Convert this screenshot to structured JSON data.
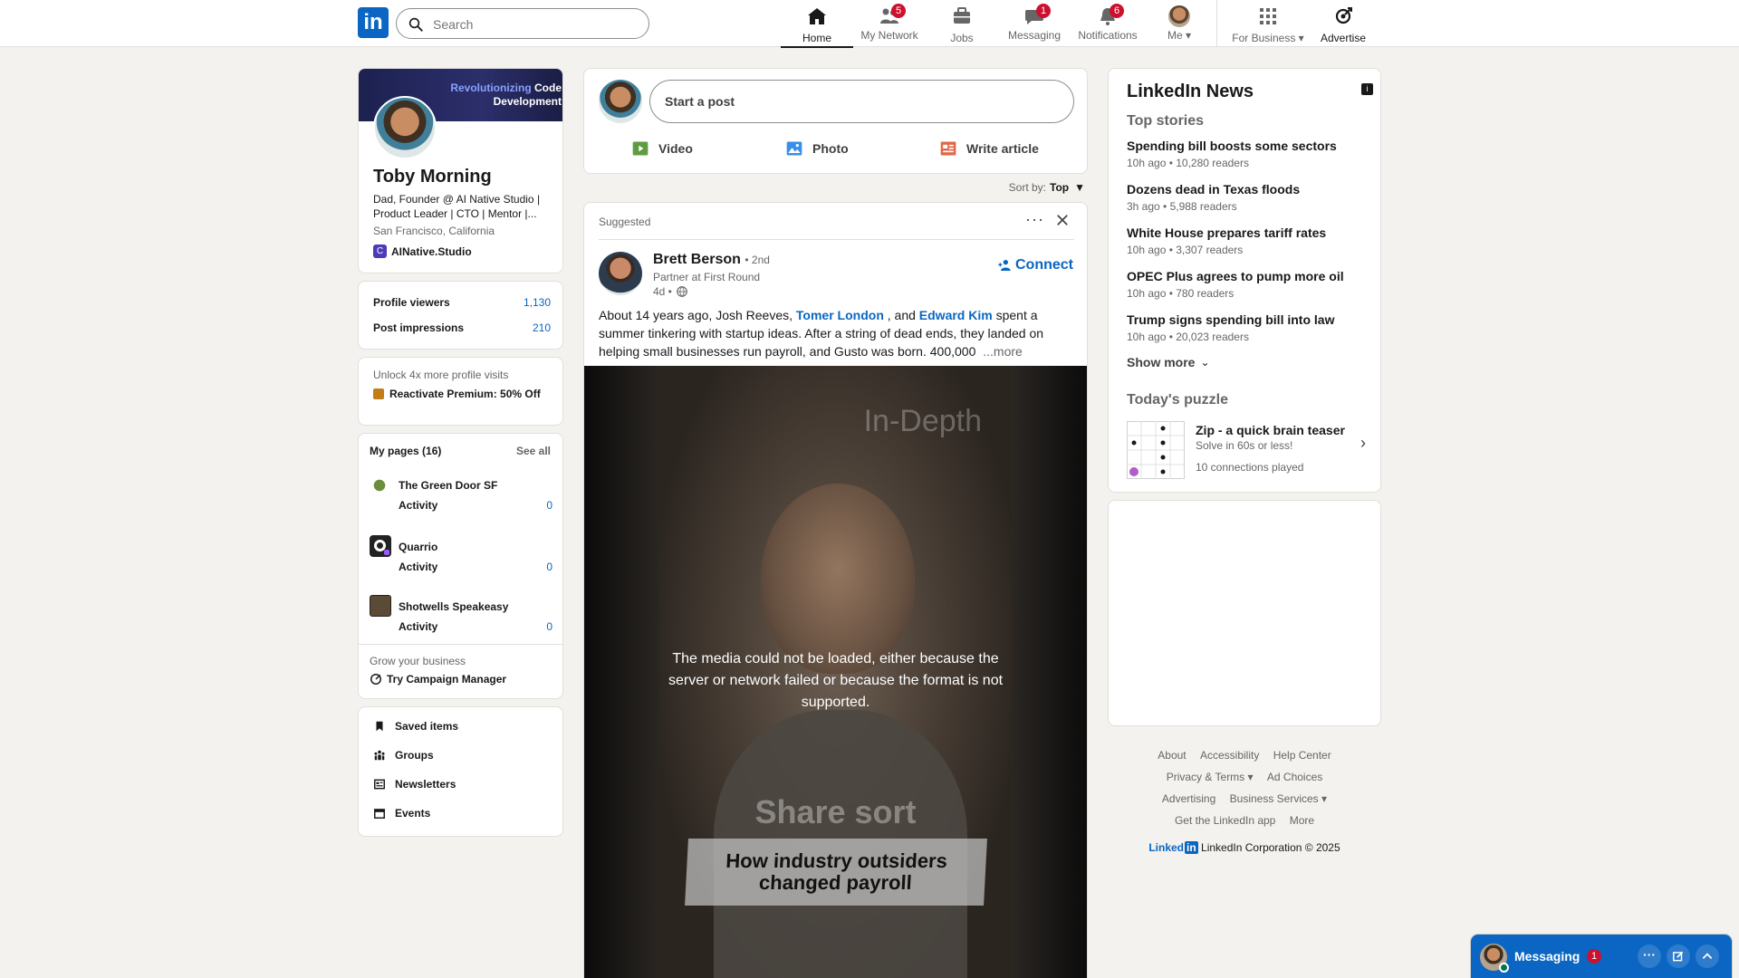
{
  "nav": {
    "search_placeholder": "Search",
    "items": [
      {
        "label": "Home"
      },
      {
        "label": "My Network",
        "badge": "5"
      },
      {
        "label": "Jobs"
      },
      {
        "label": "Messaging",
        "badge": "1"
      },
      {
        "label": "Notifications",
        "badge": "6"
      },
      {
        "label": "Me"
      },
      {
        "label": "For Business"
      },
      {
        "label": "Advertise"
      }
    ],
    "logo_text": "in"
  },
  "profile": {
    "banner_line1": "Revolutionizing",
    "banner_line1b": "Code",
    "banner_line2": "Development",
    "name": "Toby Morning",
    "headline": "Dad, Founder @ AI Native Studio | Product Leader | CTO | Mentor |...",
    "location": "San Francisco, California",
    "company": "AINative.Studio",
    "company_initial": "C",
    "stats": [
      {
        "label": "Profile viewers",
        "value": "1,130"
      },
      {
        "label": "Post impressions",
        "value": "210"
      }
    ],
    "premium_title": "Unlock 4x more profile visits",
    "premium_cta": "Reactivate Premium: 50% Off"
  },
  "pages": {
    "title": "My pages (16)",
    "see_all": "See all",
    "items": [
      {
        "name": "The Green Door SF",
        "activity": "Activity",
        "count": "0"
      },
      {
        "name": "Quarrio",
        "activity": "Activity",
        "count": "0"
      },
      {
        "name": "Shotwells Speakeasy",
        "activity": "Activity",
        "count": "0"
      }
    ],
    "grow_title": "Grow your business",
    "grow_cta": "Try Campaign Manager"
  },
  "shortcuts": [
    {
      "label": "Saved items",
      "icon": "bookmark-icon"
    },
    {
      "label": "Groups",
      "icon": "groups-icon"
    },
    {
      "label": "Newsletters",
      "icon": "newsletter-icon"
    },
    {
      "label": "Events",
      "icon": "calendar-icon"
    }
  ],
  "composer": {
    "placeholder": "Start a post",
    "actions": [
      {
        "label": "Video",
        "color": "#5f9b41"
      },
      {
        "label": "Photo",
        "color": "#378fe9"
      },
      {
        "label": "Write article",
        "color": "#e06847"
      }
    ]
  },
  "sort": {
    "label": "Sort by:",
    "value": "Top"
  },
  "post": {
    "suggested": "Suggested",
    "author": "Brett Berson",
    "degree": "• 2nd",
    "subtitle": "Partner at First Round",
    "time": "4d •",
    "connect": "Connect",
    "text_before": "About 14 years ago, Josh Reeves, ",
    "mention1": "Tomer London",
    "text_mid": " , and ",
    "mention2": "Edward Kim",
    "text_after": " spent a summer tinkering with startup ideas. After a string of dead ends, they landed on helping small businesses run payroll, and Gusto was born. 400,000",
    "more": "...more",
    "video_overlay_top": "In-Depth",
    "video_error": "The media could not be loaded, either because the server or network failed or because the format is not supported.",
    "video_title1": "Share sort",
    "video_title2": "How industry outsiders changed payroll"
  },
  "news": {
    "title": "LinkedIn News",
    "subtitle": "Top stories",
    "items": [
      {
        "headline": "Spending bill boosts some sectors",
        "meta": "10h ago • 10,280 readers"
      },
      {
        "headline": "Dozens dead in Texas floods",
        "meta": "3h ago • 5,988 readers"
      },
      {
        "headline": "White House prepares tariff rates",
        "meta": "10h ago • 3,307 readers"
      },
      {
        "headline": "OPEC Plus agrees to pump more oil",
        "meta": "10h ago • 780 readers"
      },
      {
        "headline": "Trump signs spending bill into law",
        "meta": "10h ago • 20,023 readers"
      }
    ],
    "show_more": "Show more",
    "puzzle_title": "Today's puzzle",
    "puzzle_name": "Zip - a quick brain teaser",
    "puzzle_sub": "Solve in 60s or less!",
    "puzzle_meta": "10 connections played"
  },
  "footer": {
    "row1": [
      "About",
      "Accessibility",
      "Help Center"
    ],
    "row2": [
      "Privacy & Terms",
      "Ad Choices"
    ],
    "row3": [
      "Advertising",
      "Business Services"
    ],
    "row4": [
      "Get the LinkedIn app",
      "More"
    ],
    "brand": "Linked",
    "brand_in": "in",
    "copyright": "LinkedIn Corporation © 2025"
  },
  "messaging": {
    "label": "Messaging",
    "badge": "1"
  }
}
